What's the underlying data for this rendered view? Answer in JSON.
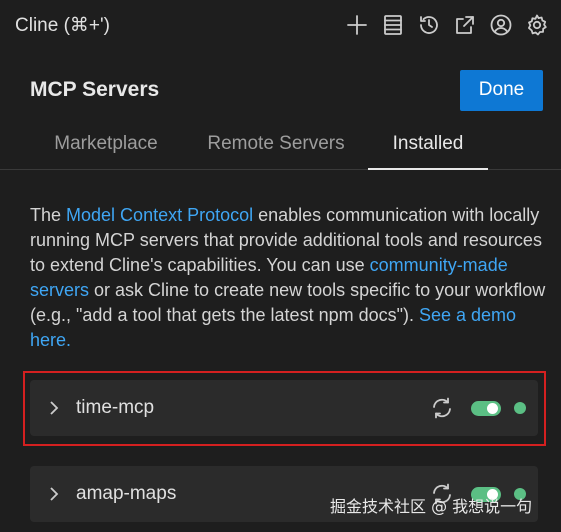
{
  "app": {
    "title": "Cline (⌘+')"
  },
  "toolbar": {
    "icons": [
      "plus-icon",
      "server-icon",
      "history-icon",
      "external-link-icon",
      "account-icon",
      "gear-icon"
    ]
  },
  "header": {
    "title": "MCP Servers",
    "done_label": "Done"
  },
  "tabs": [
    {
      "label": "Marketplace",
      "active": false
    },
    {
      "label": "Remote Servers",
      "active": false
    },
    {
      "label": "Installed",
      "active": true
    }
  ],
  "description": {
    "part1": "The ",
    "link1": "Model Context Protocol",
    "part2": " enables communication with locally running MCP servers that provide additional tools and resources to extend Cline's capabilities. You can use ",
    "link2": "community-made servers",
    "part3": " or ask Cline to create new tools specific to your workflow (e.g., \"add a tool that gets the latest npm docs\"). ",
    "link3": "See a demo here."
  },
  "servers": [
    {
      "name": "time-mcp",
      "enabled": true,
      "status": "connected"
    },
    {
      "name": "amap-maps",
      "enabled": true,
      "status": "connected"
    }
  ],
  "colors": {
    "accent": "#0e78d4",
    "link": "#3fa6f4",
    "status_green": "#5bbf84",
    "highlight": "#d42020"
  },
  "watermark": "掘金技术社区 @ 我想说一句"
}
